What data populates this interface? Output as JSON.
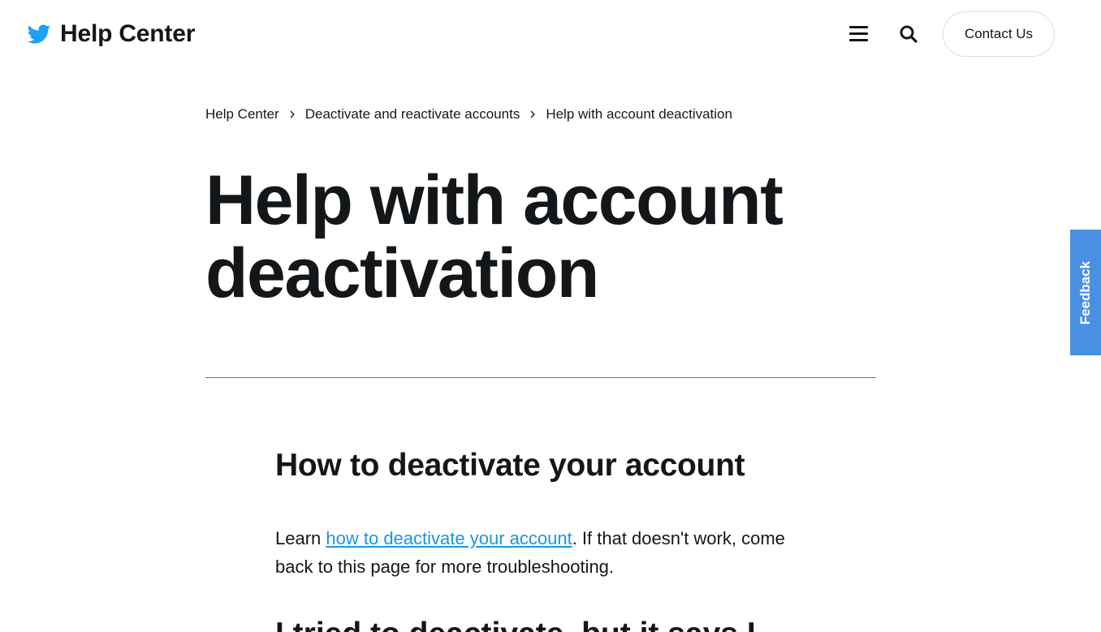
{
  "header": {
    "brand_title": "Help Center",
    "brand_icon": "twitter-bird-icon",
    "menu_icon": "hamburger-menu-icon",
    "search_icon": "search-icon",
    "contact_label": "Contact Us"
  },
  "breadcrumb": {
    "items": [
      {
        "label": "Help Center"
      },
      {
        "label": "Deactivate and reactivate accounts"
      },
      {
        "label": "Help with account deactivation"
      }
    ]
  },
  "page": {
    "title": "Help with account deactivation"
  },
  "article": {
    "section_heading": "How to deactivate your account",
    "para_prefix": "Learn ",
    "para_link": "how to deactivate your account",
    "para_suffix": ". If that doesn't work, come back to this page for more troubleshooting.",
    "next_heading": "I tried to deactivate, but it says I"
  },
  "feedback": {
    "label": "Feedback"
  },
  "colors": {
    "brand_blue": "#1da1f2",
    "link_blue": "#1b95e0",
    "feedback_blue": "#4a90e2",
    "text": "#14171a"
  }
}
